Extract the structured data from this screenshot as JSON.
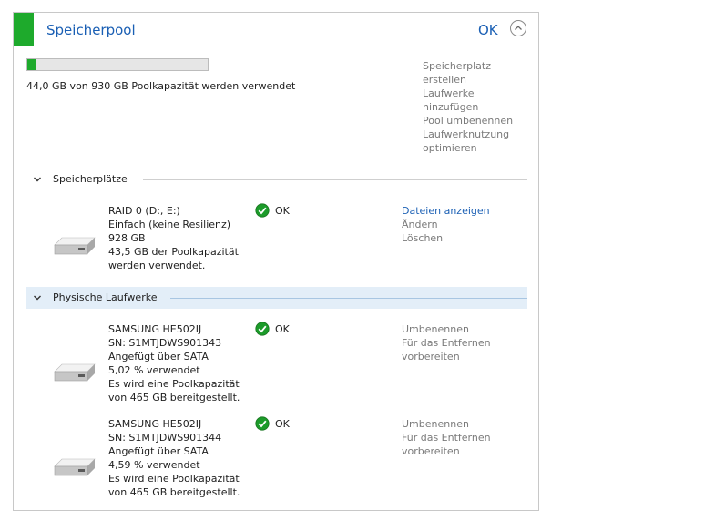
{
  "colors": {
    "accent_green": "#1eaa2c",
    "link_blue": "#1a5fb4",
    "disabled_gray": "#7a7a7a",
    "highlight": "#e3eef8"
  },
  "header": {
    "title": "Speicherpool",
    "status": "OK",
    "collapse_icon": "chevron-up-circle-icon"
  },
  "pool": {
    "usage_fraction": 0.047,
    "usage_text": "44,0 GB von 930 GB Poolkapazität werden verwendet"
  },
  "pool_actions": [
    {
      "label_lines": [
        "Speicherplatz",
        "erstellen"
      ]
    },
    {
      "label_lines": [
        "Laufwerke",
        "hinzufügen"
      ]
    },
    {
      "label_lines": [
        "Pool umbenennen"
      ]
    },
    {
      "label_lines": [
        "Laufwerknutzung",
        "optimieren"
      ]
    }
  ],
  "sections": {
    "spaces": {
      "label": "Speicherplätze"
    },
    "physical": {
      "label": "Physische Laufwerke"
    }
  },
  "spaces": [
    {
      "lines": [
        "RAID 0 (D:, E:)",
        "Einfach (keine Resilienz)",
        "928 GB",
        "43,5 GB der Poolkapazität",
        "werden verwendet."
      ],
      "status": "OK",
      "actions": [
        "Dateien anzeigen",
        "Ändern",
        "Löschen"
      ]
    }
  ],
  "drives": [
    {
      "lines": [
        "SAMSUNG HE502IJ",
        "SN: S1MTJDWS901343",
        "Angefügt über SATA",
        "5,02 % verwendet",
        "Es wird eine Poolkapazität",
        "von 465 GB bereitgestellt."
      ],
      "status": "OK",
      "action_lines": [
        "Umbenennen",
        "Für das Entfernen",
        "vorbereiten"
      ]
    },
    {
      "lines": [
        "SAMSUNG HE502IJ",
        "SN: S1MTJDWS901344",
        "Angefügt über SATA",
        "4,59 % verwendet",
        "Es wird eine Poolkapazität",
        "von 465 GB bereitgestellt."
      ],
      "status": "OK",
      "action_lines": [
        "Umbenennen",
        "Für das Entfernen",
        "vorbereiten"
      ]
    }
  ]
}
